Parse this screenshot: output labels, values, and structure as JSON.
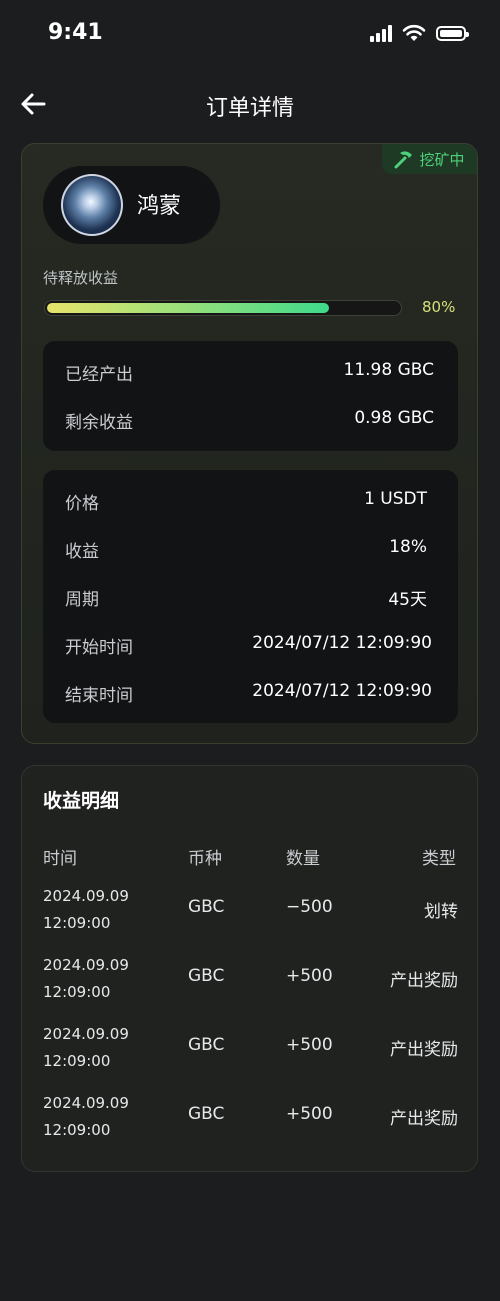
{
  "status_bar": {
    "time": "9:41"
  },
  "nav": {
    "title": "订单详情",
    "back_icon": "arrow-left-icon"
  },
  "order": {
    "status_badge": "挖矿中",
    "status_color": "#4fd07a",
    "product_name": "鸿蒙",
    "pending_label": "待释放收益",
    "progress": 0.8,
    "progress_text": "80%",
    "output": [
      {
        "label": "已经产出",
        "value": "11.98 GBC"
      },
      {
        "label": "剩余收益",
        "value": "0.98 GBC"
      }
    ],
    "details": [
      {
        "label": "价格",
        "value": "1 USDT"
      },
      {
        "label": "收益",
        "value": "18%"
      },
      {
        "label": "周期",
        "value": "45天"
      },
      {
        "label": "开始时间",
        "value": "2024/07/12 12:09:90"
      },
      {
        "label": "结束时间",
        "value": "2024/07/12 12:09:90"
      }
    ]
  },
  "income": {
    "title": "收益明细",
    "headers": {
      "time": "时间",
      "coin": "币种",
      "amount": "数量",
      "type": "类型"
    },
    "rows": [
      {
        "date": "2024.09.09",
        "clock": "12:09:00",
        "coin": "GBC",
        "amount": "−500",
        "type": "划转"
      },
      {
        "date": "2024.09.09",
        "clock": "12:09:00",
        "coin": "GBC",
        "amount": "+500",
        "type": "产出奖励"
      },
      {
        "date": "2024.09.09",
        "clock": "12:09:00",
        "coin": "GBC",
        "amount": "+500",
        "type": "产出奖励"
      },
      {
        "date": "2024.09.09",
        "clock": "12:09:00",
        "coin": "GBC",
        "amount": "+500",
        "type": "产出奖励"
      }
    ]
  }
}
